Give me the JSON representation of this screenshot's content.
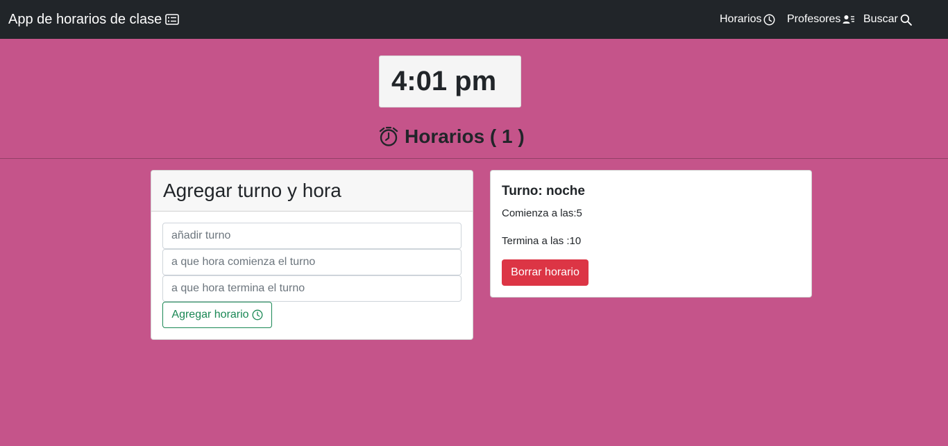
{
  "navbar": {
    "brand": "App de horarios de clase",
    "links": {
      "horarios": "Horarios",
      "profesores": "Profesores",
      "buscar": "Buscar"
    }
  },
  "clock": {
    "time": "4:01 pm"
  },
  "heading": {
    "title": "Horarios ( 1 )"
  },
  "form": {
    "title": "Agregar turno y hora",
    "turno_placeholder": "añadir turno",
    "comienza_placeholder": "a que hora comienza el turno",
    "termina_placeholder": "a que hora termina el turno",
    "submit_label": "Agregar horario"
  },
  "schedules": [
    {
      "title": "Turno: noche",
      "start": "Comienza a las:5",
      "end": "Termina a las :10",
      "delete_label": "Borrar horario"
    }
  ],
  "colors": {
    "background": "#c5548a",
    "navbar": "#212529",
    "success": "#198754",
    "danger": "#dc3545"
  },
  "icons": [
    "card-list-icon",
    "clock-icon",
    "person-lines-icon",
    "search-icon",
    "alarm-icon"
  ]
}
